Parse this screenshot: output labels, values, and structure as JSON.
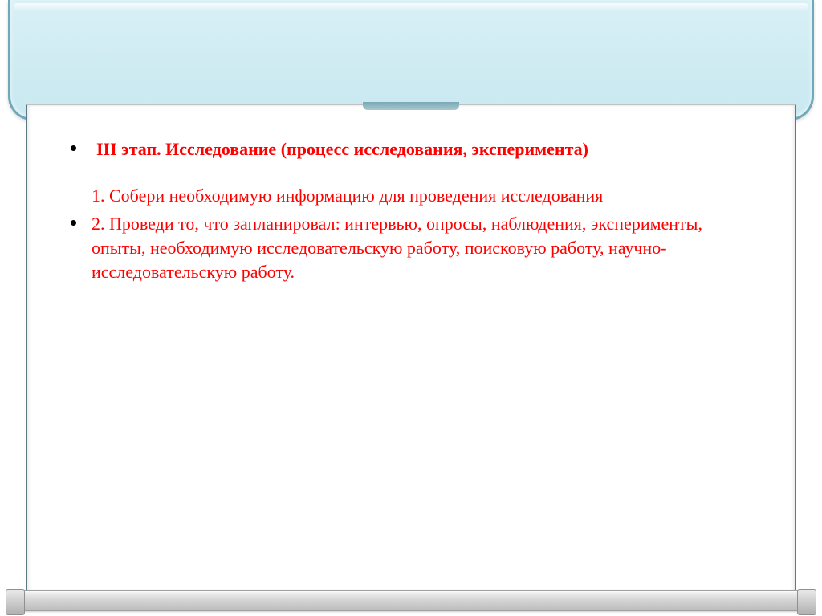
{
  "slide": {
    "heading": "III этап. Исследование (процесс исследования, эксперимента)",
    "point1": "1. Собери необходимую информацию для проведения исследования",
    "point2": "2. Проведи то, что запланировал: интервью, опросы, наблюдения, эксперименты, опыты, необходимую исследовательскую работу, поисковую работу, научно-исследовательскую работу."
  }
}
